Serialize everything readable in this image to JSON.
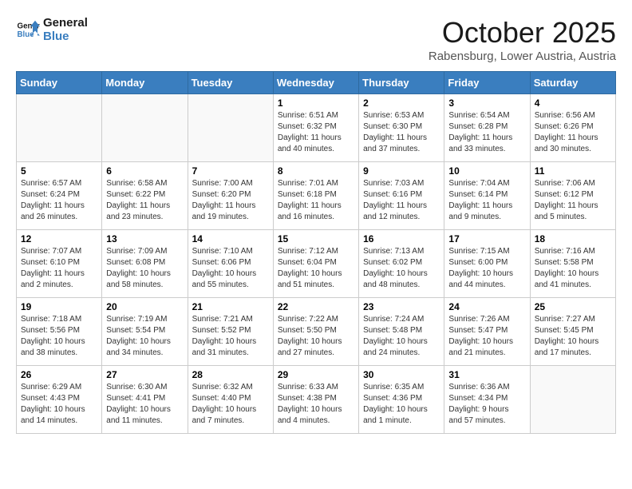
{
  "header": {
    "logo_line1": "General",
    "logo_line2": "Blue",
    "month": "October 2025",
    "location": "Rabensburg, Lower Austria, Austria"
  },
  "weekdays": [
    "Sunday",
    "Monday",
    "Tuesday",
    "Wednesday",
    "Thursday",
    "Friday",
    "Saturday"
  ],
  "weeks": [
    [
      {
        "day": "",
        "info": ""
      },
      {
        "day": "",
        "info": ""
      },
      {
        "day": "",
        "info": ""
      },
      {
        "day": "1",
        "info": "Sunrise: 6:51 AM\nSunset: 6:32 PM\nDaylight: 11 hours\nand 40 minutes."
      },
      {
        "day": "2",
        "info": "Sunrise: 6:53 AM\nSunset: 6:30 PM\nDaylight: 11 hours\nand 37 minutes."
      },
      {
        "day": "3",
        "info": "Sunrise: 6:54 AM\nSunset: 6:28 PM\nDaylight: 11 hours\nand 33 minutes."
      },
      {
        "day": "4",
        "info": "Sunrise: 6:56 AM\nSunset: 6:26 PM\nDaylight: 11 hours\nand 30 minutes."
      }
    ],
    [
      {
        "day": "5",
        "info": "Sunrise: 6:57 AM\nSunset: 6:24 PM\nDaylight: 11 hours\nand 26 minutes."
      },
      {
        "day": "6",
        "info": "Sunrise: 6:58 AM\nSunset: 6:22 PM\nDaylight: 11 hours\nand 23 minutes."
      },
      {
        "day": "7",
        "info": "Sunrise: 7:00 AM\nSunset: 6:20 PM\nDaylight: 11 hours\nand 19 minutes."
      },
      {
        "day": "8",
        "info": "Sunrise: 7:01 AM\nSunset: 6:18 PM\nDaylight: 11 hours\nand 16 minutes."
      },
      {
        "day": "9",
        "info": "Sunrise: 7:03 AM\nSunset: 6:16 PM\nDaylight: 11 hours\nand 12 minutes."
      },
      {
        "day": "10",
        "info": "Sunrise: 7:04 AM\nSunset: 6:14 PM\nDaylight: 11 hours\nand 9 minutes."
      },
      {
        "day": "11",
        "info": "Sunrise: 7:06 AM\nSunset: 6:12 PM\nDaylight: 11 hours\nand 5 minutes."
      }
    ],
    [
      {
        "day": "12",
        "info": "Sunrise: 7:07 AM\nSunset: 6:10 PM\nDaylight: 11 hours\nand 2 minutes."
      },
      {
        "day": "13",
        "info": "Sunrise: 7:09 AM\nSunset: 6:08 PM\nDaylight: 10 hours\nand 58 minutes."
      },
      {
        "day": "14",
        "info": "Sunrise: 7:10 AM\nSunset: 6:06 PM\nDaylight: 10 hours\nand 55 minutes."
      },
      {
        "day": "15",
        "info": "Sunrise: 7:12 AM\nSunset: 6:04 PM\nDaylight: 10 hours\nand 51 minutes."
      },
      {
        "day": "16",
        "info": "Sunrise: 7:13 AM\nSunset: 6:02 PM\nDaylight: 10 hours\nand 48 minutes."
      },
      {
        "day": "17",
        "info": "Sunrise: 7:15 AM\nSunset: 6:00 PM\nDaylight: 10 hours\nand 44 minutes."
      },
      {
        "day": "18",
        "info": "Sunrise: 7:16 AM\nSunset: 5:58 PM\nDaylight: 10 hours\nand 41 minutes."
      }
    ],
    [
      {
        "day": "19",
        "info": "Sunrise: 7:18 AM\nSunset: 5:56 PM\nDaylight: 10 hours\nand 38 minutes."
      },
      {
        "day": "20",
        "info": "Sunrise: 7:19 AM\nSunset: 5:54 PM\nDaylight: 10 hours\nand 34 minutes."
      },
      {
        "day": "21",
        "info": "Sunrise: 7:21 AM\nSunset: 5:52 PM\nDaylight: 10 hours\nand 31 minutes."
      },
      {
        "day": "22",
        "info": "Sunrise: 7:22 AM\nSunset: 5:50 PM\nDaylight: 10 hours\nand 27 minutes."
      },
      {
        "day": "23",
        "info": "Sunrise: 7:24 AM\nSunset: 5:48 PM\nDaylight: 10 hours\nand 24 minutes."
      },
      {
        "day": "24",
        "info": "Sunrise: 7:26 AM\nSunset: 5:47 PM\nDaylight: 10 hours\nand 21 minutes."
      },
      {
        "day": "25",
        "info": "Sunrise: 7:27 AM\nSunset: 5:45 PM\nDaylight: 10 hours\nand 17 minutes."
      }
    ],
    [
      {
        "day": "26",
        "info": "Sunrise: 6:29 AM\nSunset: 4:43 PM\nDaylight: 10 hours\nand 14 minutes."
      },
      {
        "day": "27",
        "info": "Sunrise: 6:30 AM\nSunset: 4:41 PM\nDaylight: 10 hours\nand 11 minutes."
      },
      {
        "day": "28",
        "info": "Sunrise: 6:32 AM\nSunset: 4:40 PM\nDaylight: 10 hours\nand 7 minutes."
      },
      {
        "day": "29",
        "info": "Sunrise: 6:33 AM\nSunset: 4:38 PM\nDaylight: 10 hours\nand 4 minutes."
      },
      {
        "day": "30",
        "info": "Sunrise: 6:35 AM\nSunset: 4:36 PM\nDaylight: 10 hours\nand 1 minute."
      },
      {
        "day": "31",
        "info": "Sunrise: 6:36 AM\nSunset: 4:34 PM\nDaylight: 9 hours\nand 57 minutes."
      },
      {
        "day": "",
        "info": ""
      }
    ]
  ]
}
